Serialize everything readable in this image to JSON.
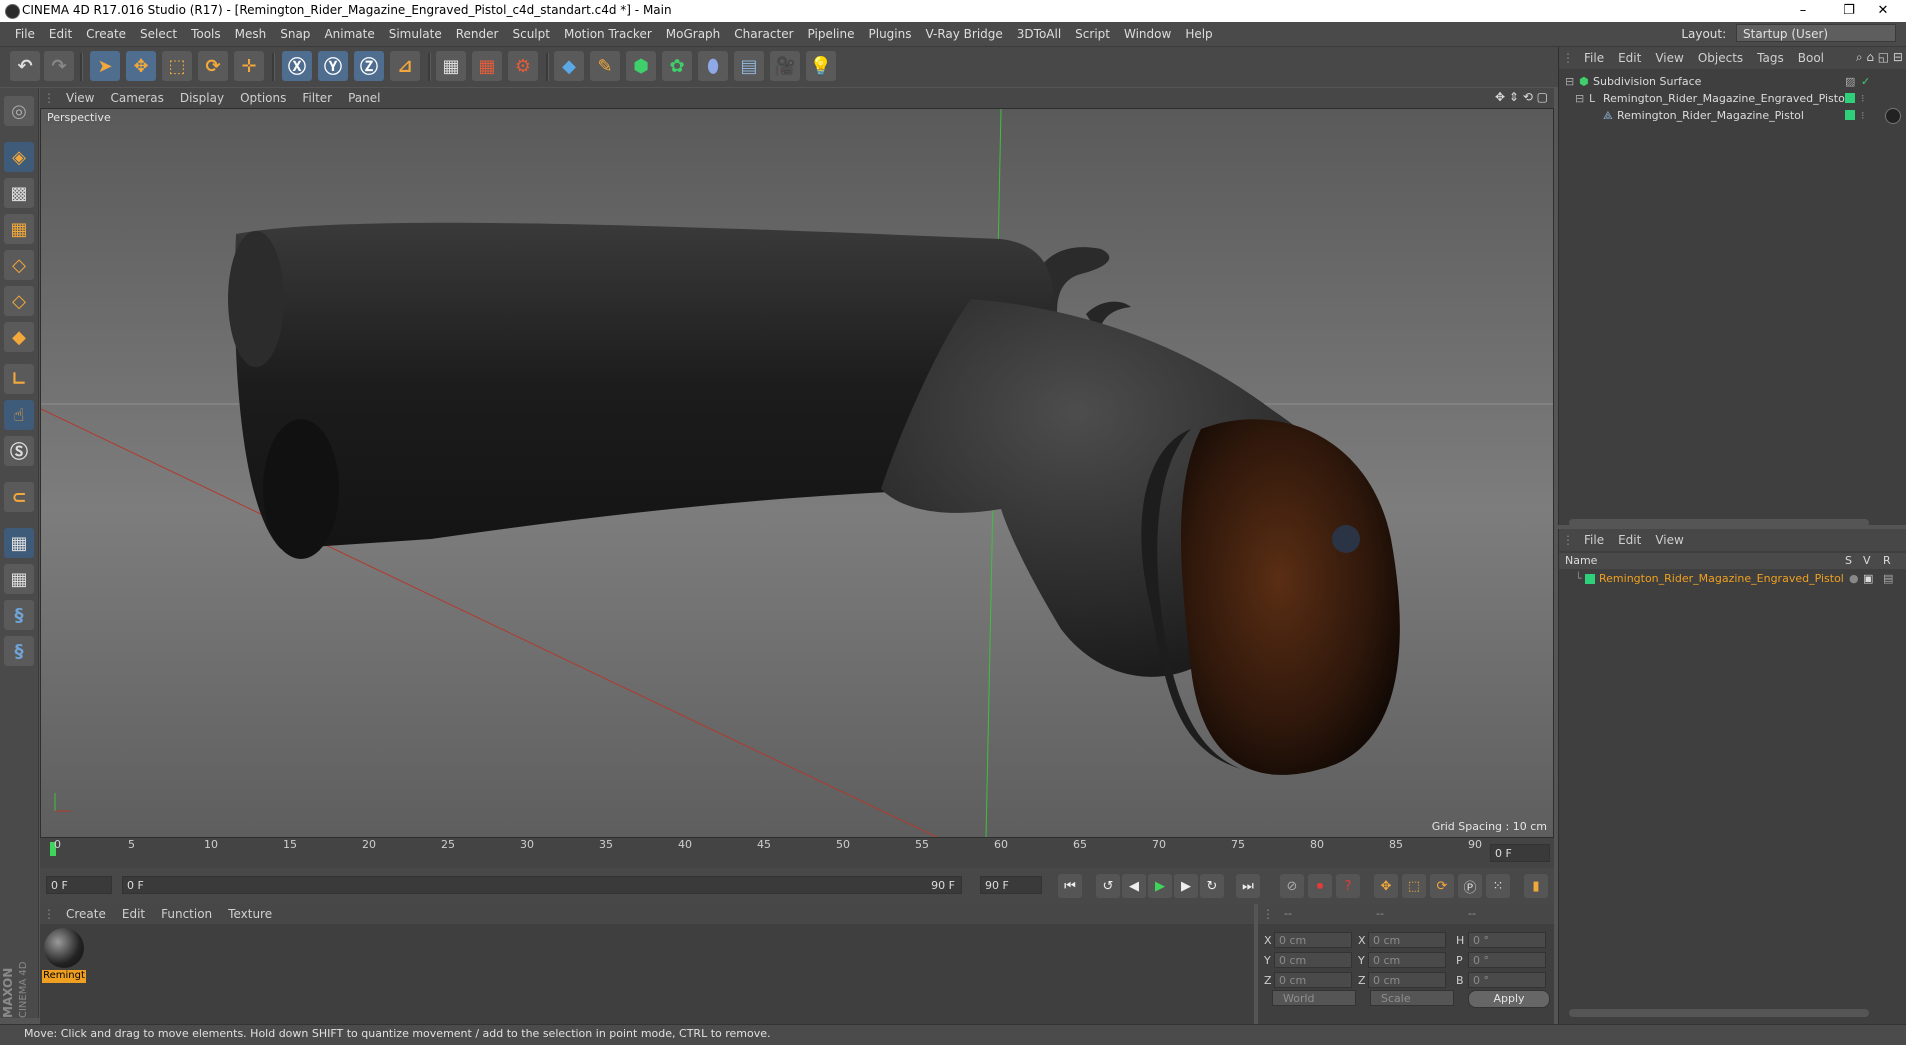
{
  "window": {
    "title": "CINEMA 4D R17.016 Studio (R17) - [Remington_Rider_Magazine_Engraved_Pistol_c4d_standart.c4d *] - Main",
    "min": "–",
    "restore": "❐",
    "close": "✕"
  },
  "menubar": {
    "items": [
      "File",
      "Edit",
      "Create",
      "Select",
      "Tools",
      "Mesh",
      "Snap",
      "Animate",
      "Simulate",
      "Render",
      "Sculpt",
      "Motion Tracker",
      "MoGraph",
      "Character",
      "Pipeline",
      "Plugins",
      "V-Ray Bridge",
      "3DToAll",
      "Script",
      "Window",
      "Help"
    ],
    "layout_label": "Layout:",
    "layout_value": "Startup (User)"
  },
  "viewport": {
    "menu": [
      "View",
      "Cameras",
      "Display",
      "Options",
      "Filter",
      "Panel"
    ],
    "camera_label": "Perspective",
    "grid_spacing": "Grid Spacing : 10 cm"
  },
  "timeline": {
    "ticks": [
      "0",
      "5",
      "10",
      "15",
      "20",
      "25",
      "30",
      "35",
      "40",
      "45",
      "50",
      "55",
      "60",
      "65",
      "70",
      "75",
      "80",
      "85",
      "90"
    ],
    "current_frame": "0 F",
    "start_field": "0 F",
    "range_start": "0 F",
    "range_end": "90 F",
    "end_field": "90 F"
  },
  "material_manager": {
    "menu": [
      "Create",
      "Edit",
      "Function",
      "Texture"
    ],
    "material_name": "Remingt"
  },
  "coordinates": {
    "headers": [
      "--",
      "--",
      "--"
    ],
    "rows": [
      {
        "a": "X",
        "av": "0 cm",
        "b": "X",
        "bv": "0 cm",
        "c": "H",
        "cv": "0 °"
      },
      {
        "a": "Y",
        "av": "0 cm",
        "b": "Y",
        "bv": "0 cm",
        "c": "P",
        "cv": "0 °"
      },
      {
        "a": "Z",
        "av": "0 cm",
        "b": "Z",
        "bv": "0 cm",
        "c": "B",
        "cv": "0 °"
      }
    ],
    "space": "World",
    "mode": "Scale",
    "apply": "Apply"
  },
  "object_manager": {
    "menu": [
      "File",
      "Edit",
      "View",
      "Objects",
      "Tags",
      "Bool"
    ],
    "objects": [
      {
        "name": "Subdivision Surface"
      },
      {
        "name": "Remington_Rider_Magazine_Engraved_Pistol"
      },
      {
        "name": "Remington_Rider_Magazine_Pistol"
      }
    ]
  },
  "attributes": {
    "menu": [
      "File",
      "Edit",
      "View"
    ],
    "columns": {
      "name": "Name",
      "s": "S",
      "v": "V",
      "r": "R"
    },
    "selected": "Remington_Rider_Magazine_Engraved_Pistol"
  },
  "status": {
    "message": "Move: Click and drag to move elements. Hold down SHIFT to quantize movement / add to the selection in point mode, CTRL to remove."
  },
  "logo": {
    "brand1": "MAXON",
    "brand2": "CINEMA 4D"
  },
  "colors": {
    "accent": "#f0a020",
    "tag": "#2ed07a",
    "playhead": "#3fd55b",
    "axis_red": "#c0392b",
    "axis_green": "#3fbf3f"
  }
}
